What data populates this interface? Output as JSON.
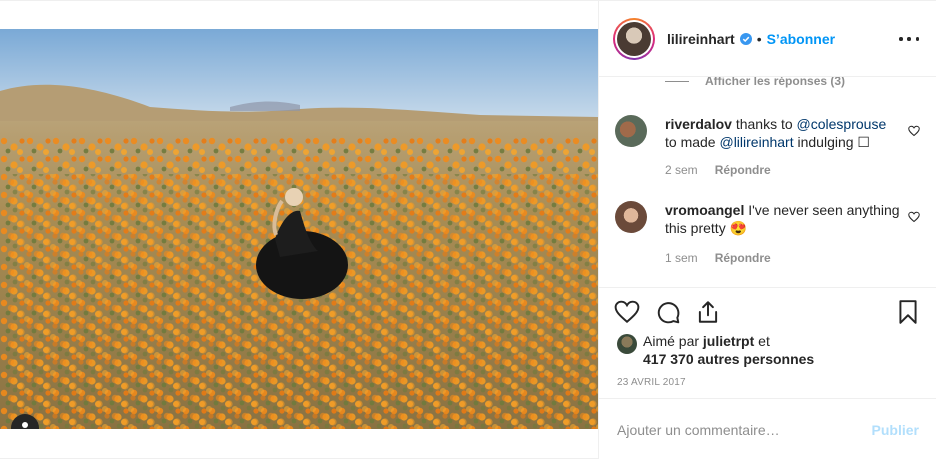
{
  "post": {
    "author": "lilireinhart",
    "follow_label": "S’abonner",
    "separator": "•"
  },
  "comments": {
    "view_replies_label": "Afficher les réponses (3)",
    "items": [
      {
        "username": "riverdalov",
        "text_before": " thanks to ",
        "mention1": "@colesprouse",
        "text_middle": " to made ",
        "mention2": "@lilireinhart",
        "text_after": " indulging ☐",
        "time": "2 sem",
        "reply_label": "Répondre"
      },
      {
        "username": "vromoangel",
        "text": " I've never seen anything this pretty 😍",
        "time": "1 sem",
        "reply_label": "Répondre"
      }
    ]
  },
  "likes": {
    "prefix": "Aimé par ",
    "first_user": "julietrpt",
    "conjunction": " et",
    "others": "417 370 autres personnes"
  },
  "date": "23 AVRIL 2017",
  "add_comment": {
    "placeholder": "Ajouter un commentaire…",
    "publish_label": "Publier"
  },
  "colors": {
    "accent_blue": "#0095f6",
    "publish_disabled": "#b2dffc",
    "muted": "#8e8e8e",
    "text": "#262626"
  },
  "icons": [
    "user-tag-icon",
    "verified-badge-icon",
    "more-options-icon",
    "heart-icon",
    "comment-icon",
    "share-icon",
    "bookmark-icon"
  ]
}
